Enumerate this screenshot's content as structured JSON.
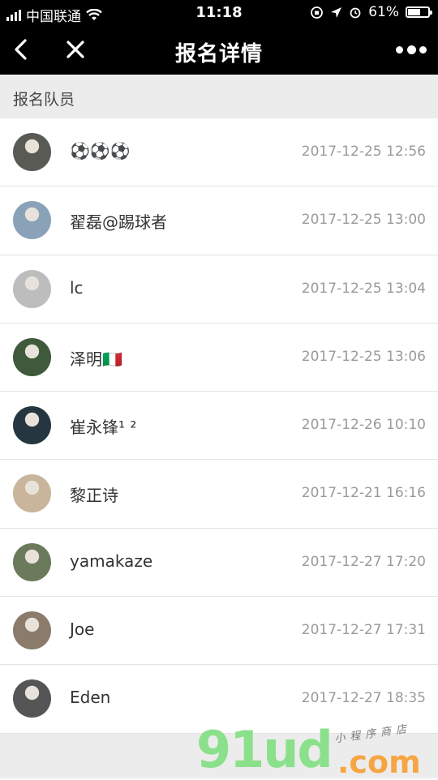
{
  "status_bar": {
    "carrier": "中国联通",
    "time": "11:18",
    "battery": "61%",
    "battery_level": 0.61
  },
  "nav": {
    "title": "报名详情"
  },
  "section": {
    "title": "报名队员"
  },
  "members": [
    {
      "name": "⚽⚽⚽",
      "time": "2017-12-25 12:56",
      "avatar_color": "#5a5a55"
    },
    {
      "name": "翟磊@踢球者",
      "time": "2017-12-25 13:00",
      "avatar_color": "#8aa2b8"
    },
    {
      "name": "lc",
      "time": "2017-12-25 13:04",
      "avatar_color": "#bdbdbd"
    },
    {
      "name": "泽明🇮🇹",
      "time": "2017-12-25 13:06",
      "avatar_color": "#3e5a3a"
    },
    {
      "name": "崔永锋¹ ²",
      "time": "2017-12-26 10:10",
      "avatar_color": "#263640"
    },
    {
      "name": "黎正诗",
      "time": "2017-12-21 16:16",
      "avatar_color": "#c9b49c"
    },
    {
      "name": "yamakaze",
      "time": "2017-12-27 17:20",
      "avatar_color": "#6b7a5a"
    },
    {
      "name": "Joe",
      "time": "2017-12-27 17:31",
      "avatar_color": "#8a7b6a"
    },
    {
      "name": "Eden",
      "time": "2017-12-27 18:35",
      "avatar_color": "#555555"
    }
  ],
  "watermark": {
    "main": "91ud",
    "suffix": ".com",
    "tagline": "小程序商店"
  }
}
